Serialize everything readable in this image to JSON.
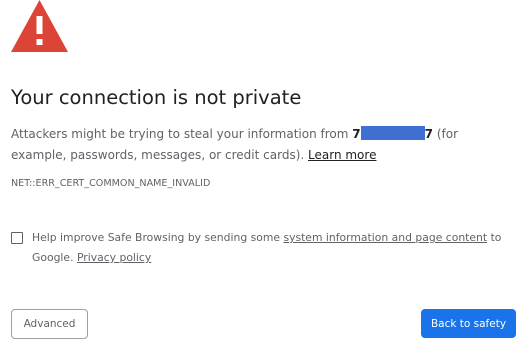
{
  "icon": "warning-triangle-icon",
  "colors": {
    "warning_red": "#db4437",
    "primary_button": "#1a73e8",
    "redaction": "#3f6fd1"
  },
  "interstitial": {
    "heading": "Your connection is not private",
    "body_prefix": "Attackers might be trying to steal your information from ",
    "host_start": "7",
    "host_end": "7",
    "body_suffix": " (for example, passwords, messages, or credit cards). ",
    "learn_more": "Learn more",
    "error_code": "NET::ERR_CERT_COMMON_NAME_INVALID"
  },
  "safe_browsing": {
    "text_prefix": "Help improve Safe Browsing by sending some ",
    "link_text": "system information and page content",
    "text_suffix": " to Google. ",
    "privacy_link": "Privacy policy",
    "checked": false
  },
  "buttons": {
    "advanced": "Advanced",
    "back_to_safety": "Back to safety"
  }
}
